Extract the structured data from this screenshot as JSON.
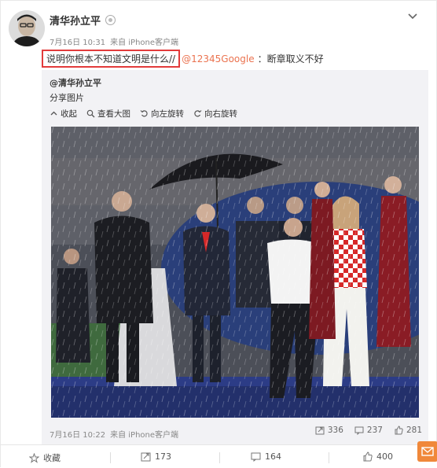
{
  "post": {
    "author": "清华孙立平",
    "time": "7月16日 10:31",
    "source": "来自 iPhone客户端",
    "highlighted_text": "说明你根本不知道文明是什么//",
    "mention": "@12345Google",
    "rest_text": "：断章取义不好"
  },
  "repost": {
    "author": "@清华孙立平",
    "subtitle": "分享图片",
    "tools": [
      "收起",
      "查看大图",
      "向左旋转",
      "向右旋转"
    ],
    "time": "7月16日 10:22",
    "source": "来自 iPhone客户端",
    "stats": {
      "reposts": "336",
      "comments": "237",
      "likes": "281"
    }
  },
  "bottom_bar": {
    "favorite": "收藏",
    "repost": "173",
    "comment": "164",
    "like": "400"
  },
  "colors": {
    "highlight_border": "#e23b3b",
    "mention": "#eb7350",
    "repost_bg": "#f2f2f5",
    "accent_orange": "#f0883a"
  },
  "icons": [
    "verified-badge-icon",
    "chevron-down-icon",
    "collapse-icon",
    "zoom-icon",
    "rotate-left-icon",
    "rotate-right-icon",
    "repost-icon",
    "comment-icon",
    "like-icon",
    "star-icon",
    "mail-icon"
  ]
}
